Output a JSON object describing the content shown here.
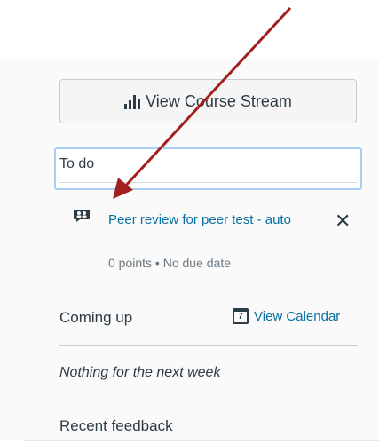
{
  "stream_button": {
    "label": "View Course Stream",
    "icon": "bar-chart-icon"
  },
  "todo": {
    "heading": "To do",
    "items": [
      {
        "icon": "peer-review-icon",
        "title": "Peer review for peer test - auto",
        "meta": "0 points • No due date",
        "dismiss": "✕"
      }
    ]
  },
  "coming_up": {
    "heading": "Coming up",
    "calendar_link": "View Calendar",
    "calendar_icon_day": "7",
    "empty_text": "Nothing for the next week"
  },
  "recent_feedback": {
    "heading": "Recent feedback"
  },
  "colors": {
    "link": "#0770a3",
    "text": "#2d3b45",
    "annotation_arrow": "#a31f1f",
    "focus_border": "#a9cff7"
  }
}
